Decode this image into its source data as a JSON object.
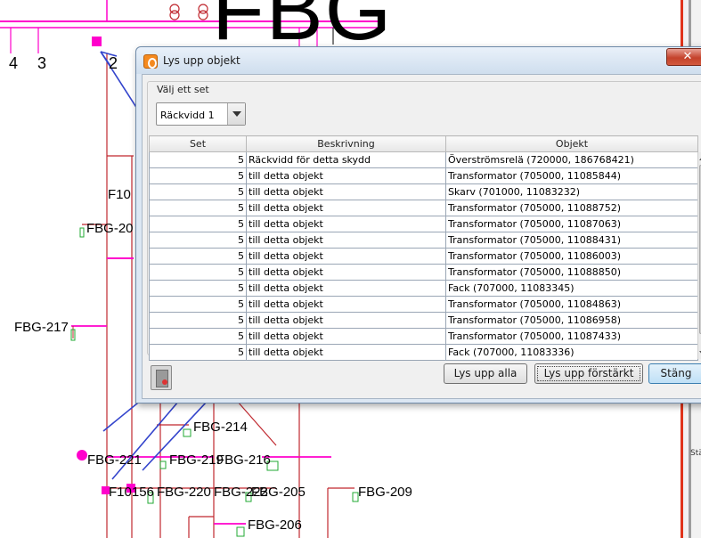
{
  "diagram": {
    "big_text": "FBG",
    "labels": {
      "n4": "4",
      "n3": "3",
      "n2": "2",
      "f10": "F10",
      "fbg20": "FBG-20",
      "fbg217": "FBG-217",
      "fbg214": "FBG-214",
      "fbg221": "FBG-221",
      "fbg219": "FBG-219",
      "fbg216": "FBG-216",
      "f10156": "F10156",
      "fbg220": "FBG-220",
      "fbg222": "FBG-222",
      "fbg205": "FBG-205",
      "fbg209": "FBG-209",
      "fbg206": "FBG-206"
    },
    "line_color": "#c0282f",
    "bus_color": "#ff00cc",
    "annotation_color": "#3344cc"
  },
  "dialog": {
    "title": "Lys upp objekt",
    "close_label": "✕",
    "group_title": "Välj ett set",
    "combo_value": "Räckvidd 1",
    "columns": [
      "Set",
      "Beskrivning",
      "Objekt"
    ],
    "rows": [
      {
        "set": "5",
        "desc": "Räckvidd för detta skydd",
        "obj": "Överströmsrelä (720000, 186768421)"
      },
      {
        "set": "5",
        "desc": "till detta objekt",
        "obj": "Transformator (705000, 11085844)"
      },
      {
        "set": "5",
        "desc": "till detta objekt",
        "obj": "Skarv (701000, 11083232)"
      },
      {
        "set": "5",
        "desc": "till detta objekt",
        "obj": "Transformator (705000, 11088752)"
      },
      {
        "set": "5",
        "desc": "till detta objekt",
        "obj": "Transformator (705000, 11087063)"
      },
      {
        "set": "5",
        "desc": "till detta objekt",
        "obj": "Transformator (705000, 11088431)"
      },
      {
        "set": "5",
        "desc": "till detta objekt",
        "obj": "Transformator (705000, 11086003)"
      },
      {
        "set": "5",
        "desc": "till detta objekt",
        "obj": "Transformator (705000, 11088850)"
      },
      {
        "set": "5",
        "desc": "till detta objekt",
        "obj": "Fack (707000, 11083345)"
      },
      {
        "set": "5",
        "desc": "till detta objekt",
        "obj": "Transformator (705000, 11084863)"
      },
      {
        "set": "5",
        "desc": "till detta objekt",
        "obj": "Transformator (705000, 11086958)"
      },
      {
        "set": "5",
        "desc": "till detta objekt",
        "obj": "Transformator (705000, 11087433)"
      },
      {
        "set": "5",
        "desc": "till detta objekt",
        "obj": "Fack (707000, 11083336)"
      }
    ],
    "buttons": {
      "light_all": "Lys upp alla",
      "light_enhanced": "Lys upp förstärkt",
      "close": "Stäng"
    }
  },
  "right_panel": {
    "tag": "Stä"
  }
}
